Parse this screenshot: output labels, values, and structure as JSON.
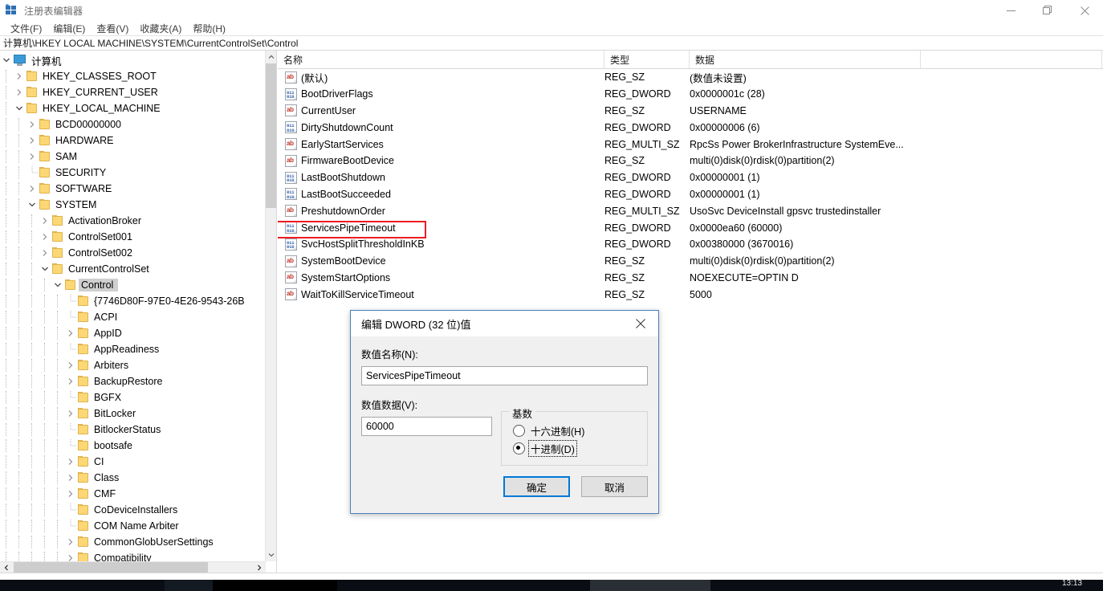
{
  "window": {
    "title": "注册表编辑器",
    "icon": "registry-editor-icon",
    "controls": {
      "minimize": "minimize-icon",
      "restore": "restore-icon",
      "close": "close-icon"
    }
  },
  "menubar": {
    "items": [
      {
        "label": "文件(F)"
      },
      {
        "label": "编辑(E)"
      },
      {
        "label": "查看(V)"
      },
      {
        "label": "收藏夹(A)"
      },
      {
        "label": "帮助(H)"
      }
    ]
  },
  "address": {
    "path": "计算机\\HKEY LOCAL MACHINE\\SYSTEM\\CurrentControlSet\\Control"
  },
  "tree": {
    "nodes": [
      {
        "label": "计算机",
        "depth": 0,
        "expanded": true,
        "icon": "computer-icon"
      },
      {
        "label": "HKEY_CLASSES_ROOT",
        "depth": 1,
        "expanded": false,
        "icon": "folder-icon"
      },
      {
        "label": "HKEY_CURRENT_USER",
        "depth": 1,
        "expanded": false,
        "icon": "folder-icon"
      },
      {
        "label": "HKEY_LOCAL_MACHINE",
        "depth": 1,
        "expanded": true,
        "icon": "folder-icon"
      },
      {
        "label": "BCD00000000",
        "depth": 2,
        "expanded": false,
        "icon": "folder-icon"
      },
      {
        "label": "HARDWARE",
        "depth": 2,
        "expanded": false,
        "icon": "folder-icon"
      },
      {
        "label": "SAM",
        "depth": 2,
        "expanded": false,
        "icon": "folder-icon"
      },
      {
        "label": "SECURITY",
        "depth": 2,
        "leaf": true,
        "icon": "folder-icon"
      },
      {
        "label": "SOFTWARE",
        "depth": 2,
        "expanded": false,
        "icon": "folder-icon"
      },
      {
        "label": "SYSTEM",
        "depth": 2,
        "expanded": true,
        "icon": "folder-icon"
      },
      {
        "label": "ActivationBroker",
        "depth": 3,
        "expanded": false,
        "icon": "folder-icon"
      },
      {
        "label": "ControlSet001",
        "depth": 3,
        "expanded": false,
        "icon": "folder-icon"
      },
      {
        "label": "ControlSet002",
        "depth": 3,
        "expanded": false,
        "icon": "folder-icon"
      },
      {
        "label": "CurrentControlSet",
        "depth": 3,
        "expanded": true,
        "icon": "folder-icon"
      },
      {
        "label": "Control",
        "depth": 4,
        "expanded": true,
        "selected": true,
        "icon": "folder-icon"
      },
      {
        "label": "{7746D80F-97E0-4E26-9543-26B",
        "depth": 5,
        "leaf": true,
        "icon": "folder-icon"
      },
      {
        "label": "ACPI",
        "depth": 5,
        "leaf": true,
        "icon": "folder-icon"
      },
      {
        "label": "AppID",
        "depth": 5,
        "expanded": false,
        "icon": "folder-icon"
      },
      {
        "label": "AppReadiness",
        "depth": 5,
        "leaf": true,
        "icon": "folder-icon"
      },
      {
        "label": "Arbiters",
        "depth": 5,
        "expanded": false,
        "icon": "folder-icon"
      },
      {
        "label": "BackupRestore",
        "depth": 5,
        "expanded": false,
        "icon": "folder-icon"
      },
      {
        "label": "BGFX",
        "depth": 5,
        "leaf": true,
        "icon": "folder-icon"
      },
      {
        "label": "BitLocker",
        "depth": 5,
        "expanded": false,
        "icon": "folder-icon"
      },
      {
        "label": "BitlockerStatus",
        "depth": 5,
        "leaf": true,
        "icon": "folder-icon"
      },
      {
        "label": "bootsafe",
        "depth": 5,
        "leaf": true,
        "icon": "folder-icon"
      },
      {
        "label": "CI",
        "depth": 5,
        "expanded": false,
        "icon": "folder-icon"
      },
      {
        "label": "Class",
        "depth": 5,
        "expanded": false,
        "icon": "folder-icon"
      },
      {
        "label": "CMF",
        "depth": 5,
        "expanded": false,
        "icon": "folder-icon"
      },
      {
        "label": "CoDeviceInstallers",
        "depth": 5,
        "leaf": true,
        "icon": "folder-icon"
      },
      {
        "label": "COM Name Arbiter",
        "depth": 5,
        "leaf": true,
        "icon": "folder-icon"
      },
      {
        "label": "CommonGlobUserSettings",
        "depth": 5,
        "expanded": false,
        "icon": "folder-icon"
      },
      {
        "label": "Compatibility",
        "depth": 5,
        "expanded": false,
        "icon": "folder-icon"
      }
    ]
  },
  "list": {
    "columns": [
      {
        "label": "名称"
      },
      {
        "label": "类型"
      },
      {
        "label": "数据"
      },
      {
        "label": ""
      }
    ],
    "rows": [
      {
        "name": "(默认)",
        "type": "REG_SZ",
        "data": "(数值未设置)",
        "icon": "string-value-icon"
      },
      {
        "name": "BootDriverFlags",
        "type": "REG_DWORD",
        "data": "0x0000001c (28)",
        "icon": "dword-value-icon"
      },
      {
        "name": "CurrentUser",
        "type": "REG_SZ",
        "data": "USERNAME",
        "icon": "string-value-icon"
      },
      {
        "name": "DirtyShutdownCount",
        "type": "REG_DWORD",
        "data": "0x00000006 (6)",
        "icon": "dword-value-icon"
      },
      {
        "name": "EarlyStartServices",
        "type": "REG_MULTI_SZ",
        "data": "RpcSs Power BrokerInfrastructure SystemEve...",
        "icon": "string-value-icon"
      },
      {
        "name": "FirmwareBootDevice",
        "type": "REG_SZ",
        "data": "multi(0)disk(0)rdisk(0)partition(2)",
        "icon": "string-value-icon"
      },
      {
        "name": "LastBootShutdown",
        "type": "REG_DWORD",
        "data": "0x00000001 (1)",
        "icon": "dword-value-icon"
      },
      {
        "name": "LastBootSucceeded",
        "type": "REG_DWORD",
        "data": "0x00000001 (1)",
        "icon": "dword-value-icon"
      },
      {
        "name": "PreshutdownOrder",
        "type": "REG_MULTI_SZ",
        "data": "UsoSvc DeviceInstall gpsvc trustedinstaller",
        "icon": "string-value-icon"
      },
      {
        "name": "ServicesPipeTimeout",
        "type": "REG_DWORD",
        "data": "0x0000ea60 (60000)",
        "icon": "dword-value-icon",
        "highlighted": true
      },
      {
        "name": "SvcHostSplitThresholdInKB",
        "type": "REG_DWORD",
        "data": "0x00380000 (3670016)",
        "icon": "dword-value-icon"
      },
      {
        "name": "SystemBootDevice",
        "type": "REG_SZ",
        "data": "multi(0)disk(0)rdisk(0)partition(2)",
        "icon": "string-value-icon"
      },
      {
        "name": "SystemStartOptions",
        "type": "REG_SZ",
        "data": " NOEXECUTE=OPTIN D",
        "icon": "string-value-icon"
      },
      {
        "name": "WaitToKillServiceTimeout",
        "type": "REG_SZ",
        "data": "5000",
        "icon": "string-value-icon"
      }
    ]
  },
  "dialog": {
    "title": "编辑 DWORD (32 位)值",
    "close_icon": "close-icon",
    "name_label": "数值名称(N):",
    "name_value": "ServicesPipeTimeout",
    "data_label": "数值数据(V):",
    "data_value": "60000",
    "base_group_label": "基数",
    "radios": [
      {
        "label": "十六进制(H)",
        "selected": false
      },
      {
        "label": "十进制(D)",
        "selected": true,
        "focused": true
      }
    ],
    "ok_label": "确定",
    "cancel_label": "取消"
  },
  "taskbar": {
    "clock": "13:13"
  },
  "colors": {
    "accent": "#0078d7",
    "highlight": "#ee1c23",
    "folder": "#fcd775",
    "string_icon": "#c0392b",
    "dword_icon": "#2b5fa8"
  }
}
